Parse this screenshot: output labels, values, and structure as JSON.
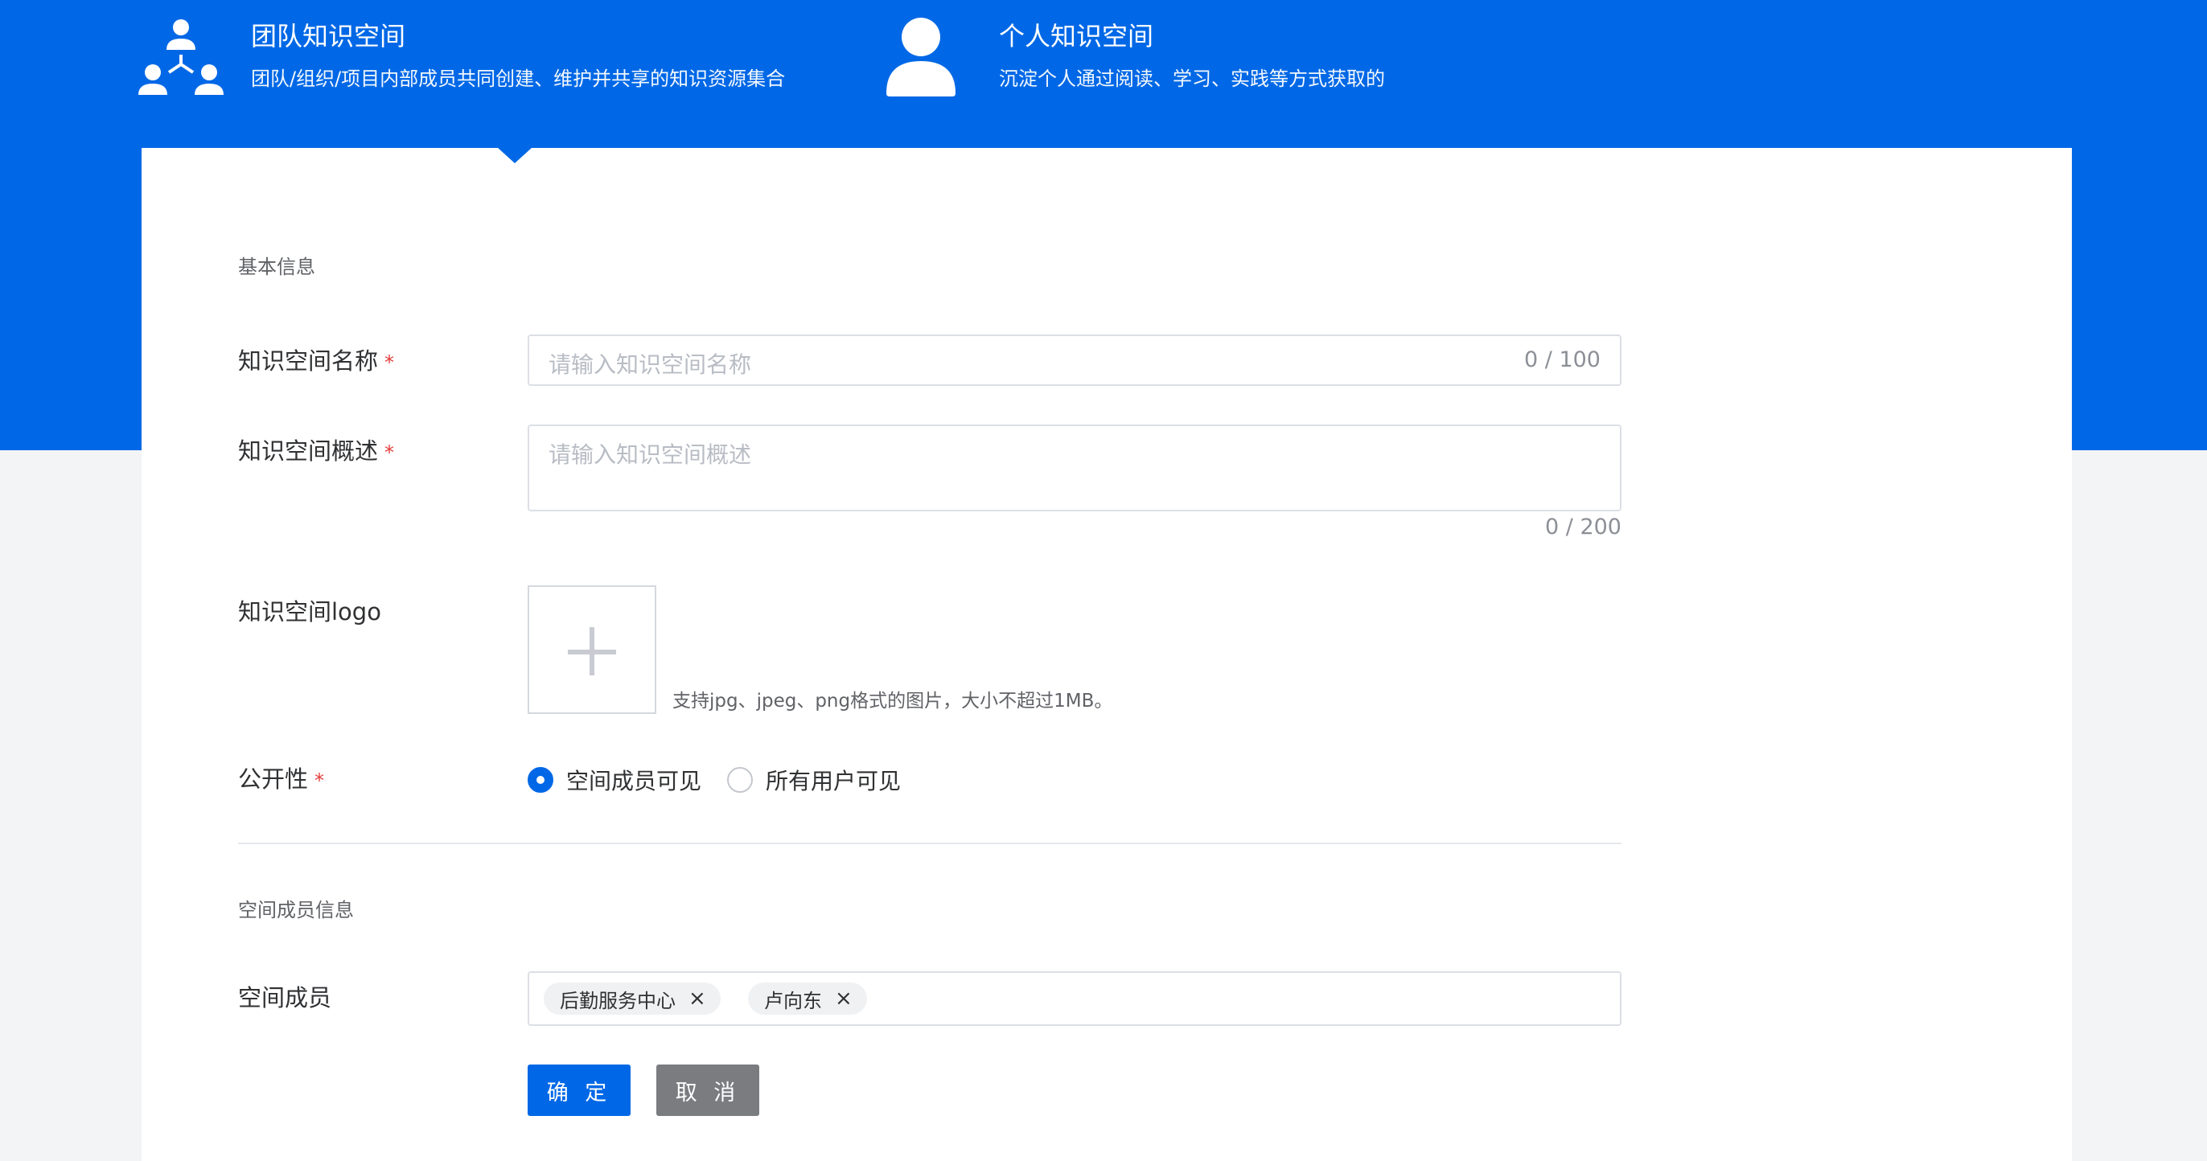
{
  "space_types": {
    "team": {
      "title": "团队知识空间",
      "desc": "团队/组织/项目内部成员共同创建、维护并共享的知识资源集合",
      "icon": "team-hierarchy-icon"
    },
    "personal": {
      "title": "个人知识空间",
      "desc": "沉淀个人通过阅读、学习、实践等方式获取的",
      "icon": "user-icon"
    },
    "selected": "team"
  },
  "basic_info": {
    "section_title": "基本信息",
    "name": {
      "label": "知识空间名称",
      "required_mark": "*",
      "placeholder": "请输入知识空间名称",
      "counter": "0 / 100"
    },
    "summary": {
      "label": "知识空间概述",
      "required_mark": "*",
      "placeholder": "请输入知识空间概述",
      "counter": "0 / 200"
    },
    "logo": {
      "label": "知识空间logo",
      "hint": "支持jpg、jpeg、png格式的图片，大小不超过1MB。",
      "icon": "plus-icon"
    },
    "visibility": {
      "label": "公开性",
      "required_mark": "*",
      "options": [
        "空间成员可见",
        "所有用户可见"
      ],
      "selected": "空间成员可见"
    }
  },
  "members_info": {
    "section_title": "空间成员信息",
    "label": "空间成员",
    "tags": [
      "后勤服务中心",
      "卢向东"
    ],
    "remove_icon": "×"
  },
  "actions": {
    "confirm": "确 定",
    "cancel": "取 消"
  },
  "colors": {
    "brand": "#0068e6",
    "required": "#e23c39",
    "cancel_button": "#7b7c80"
  }
}
